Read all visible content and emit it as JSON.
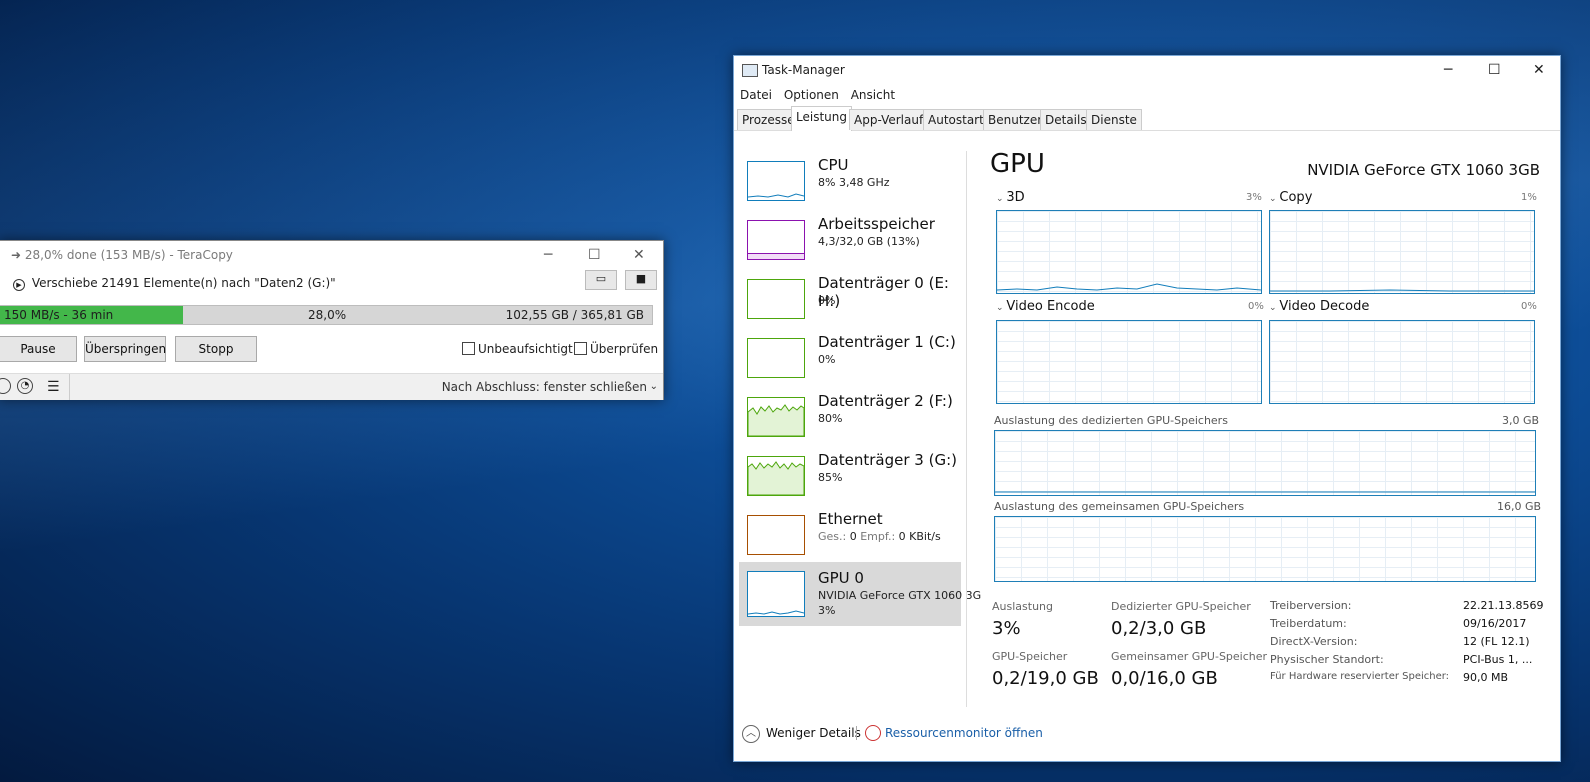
{
  "teracopy": {
    "title": "28,0% done (153 MB/s) - TeraCopy",
    "status_line": "Verschiebe 21491 Elemente(n) nach \"Daten2 (G:)\"",
    "progress": {
      "fraction": 0.28,
      "speed_time": "150 MB/s - 36 min",
      "percent": "28,0%",
      "size": "102,55 GB / 365,81 GB"
    },
    "buttons": {
      "pause": "Pause",
      "skip": "Überspringen",
      "stop": "Stopp"
    },
    "checks": {
      "unattended": "Unbeaufsichtigt",
      "verify": "Überprüfen"
    },
    "after": "Nach Abschluss: fenster schließen",
    "controls": {
      "minimize": "─",
      "maximize": "☐",
      "close": "✕"
    }
  },
  "taskmanager": {
    "title": "Task-Manager",
    "controls": {
      "minimize": "─",
      "maximize": "☐",
      "close": "✕"
    },
    "menu": [
      "Datei",
      "Optionen",
      "Ansicht"
    ],
    "tabs": [
      "Prozesse",
      "Leistung",
      "App-Verlauf",
      "Autostart",
      "Benutzer",
      "Details",
      "Dienste"
    ],
    "active_tab": "Leistung",
    "sidebar": [
      {
        "name": "CPU",
        "sub": "8% 3,48 GHz",
        "color": "#117dbb"
      },
      {
        "name": "Arbeitsspeicher",
        "sub": "4,3/32,0 GB (13%)",
        "color": "#8b12ae"
      },
      {
        "name": "Datenträger 0 (E: H:)",
        "sub": "0%",
        "color": "#4da60c"
      },
      {
        "name": "Datenträger 1 (C:)",
        "sub": "0%",
        "color": "#4da60c"
      },
      {
        "name": "Datenträger 2 (F:)",
        "sub": "80%",
        "color": "#4da60c"
      },
      {
        "name": "Datenträger 3 (G:)",
        "sub": "85%",
        "color": "#4da60c"
      },
      {
        "name": "Ethernet",
        "sub_prefix": "Ges.:",
        "sub_send": "0",
        "sub_mid": "Empf.:",
        "sub_recv": "0 KBit/s",
        "color": "#a74f01"
      },
      {
        "name": "GPU 0",
        "sub": "NVIDIA GeForce GTX 1060 3G",
        "sub2": "3%",
        "color": "#117dbb"
      }
    ],
    "gpu": {
      "heading": "GPU",
      "model": "NVIDIA GeForce GTX 1060 3GB",
      "engines": [
        {
          "label": "3D",
          "pct": "3%"
        },
        {
          "label": "Copy",
          "pct": "1%"
        },
        {
          "label": "Video Encode",
          "pct": "0%"
        },
        {
          "label": "Video Decode",
          "pct": "0%"
        }
      ],
      "dedicated_label": "Auslastung des dedizierten GPU-Speichers",
      "dedicated_max": "3,0 GB",
      "shared_label": "Auslastung des gemeinsamen GPU-Speichers",
      "shared_max": "16,0 GB",
      "stats": {
        "util_label": "Auslastung",
        "util_value": "3%",
        "ded_label": "Dedizierter GPU-Speicher",
        "ded_value": "0,2/3,0 GB",
        "mem_label": "GPU-Speicher",
        "mem_value": "0,2/19,0 GB",
        "shared_label": "Gemeinsamer GPU-Speicher",
        "shared_value": "0,0/16,0 GB"
      },
      "info": [
        {
          "k": "Treiberversion:",
          "v": "22.21.13.8569"
        },
        {
          "k": "Treiberdatum:",
          "v": "09/16/2017"
        },
        {
          "k": "DirectX-Version:",
          "v": "12 (FL 12.1)"
        },
        {
          "k": "Physischer Standort:",
          "v": "PCI-Bus 1, ..."
        },
        {
          "k": "Für Hardware reservierter Speicher:",
          "v": "90,0 MB"
        }
      ]
    },
    "footer": {
      "less": "Weniger Details",
      "monitor": "Ressourcenmonitor öffnen"
    }
  }
}
